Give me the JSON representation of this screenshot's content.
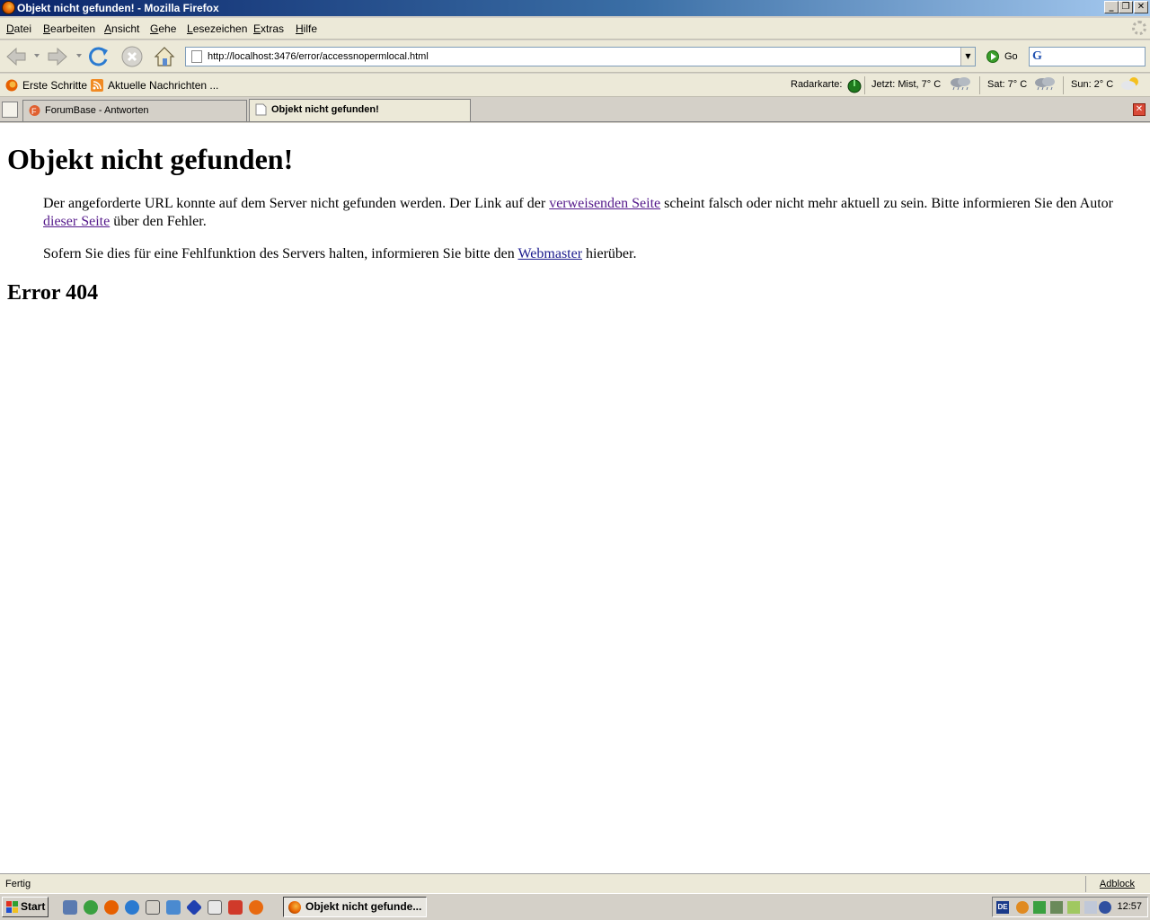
{
  "window": {
    "title": "Objekt nicht gefunden! - Mozilla Firefox"
  },
  "menu": [
    "Datei",
    "Bearbeiten",
    "Ansicht",
    "Gehe",
    "Lesezeichen",
    "Extras",
    "Hilfe"
  ],
  "nav": {
    "url": "http://localhost:3476/error/accessnopermlocal.html",
    "go_label": "Go"
  },
  "bookmarks": {
    "items": [
      "Erste Schritte",
      "Aktuelle Nachrichten ..."
    ]
  },
  "weather": {
    "radar_label": "Radarkarte:",
    "now": "Jetzt: Mist, 7° C",
    "sat": "Sat: 7° C",
    "sun": "Sun: 2° C"
  },
  "tabs": [
    {
      "label": "ForumBase - Antworten",
      "active": false
    },
    {
      "label": "Objekt nicht gefunden!",
      "active": true
    }
  ],
  "page": {
    "heading": "Objekt nicht gefunden!",
    "p1_a": "Der angeforderte URL konnte auf dem Server nicht gefunden werden. Der Link auf der ",
    "p1_link1": "verweisenden Seite",
    "p1_b": " scheint falsch oder nicht mehr aktuell zu sein. Bitte informieren Sie den Autor ",
    "p1_link2": "dieser Seite",
    "p1_c": " über den Fehler.",
    "p2_a": "Sofern Sie dies für eine Fehlfunktion des Servers halten, informieren Sie bitte den ",
    "p2_link": "Webmaster",
    "p2_b": " hierüber.",
    "error": "Error 404"
  },
  "statusbar": {
    "status": "Fertig",
    "adblock": "Adblock"
  },
  "taskbar": {
    "start": "Start",
    "task_item": "Objekt nicht gefunde...",
    "lang": "DE",
    "clock": "12:57"
  }
}
